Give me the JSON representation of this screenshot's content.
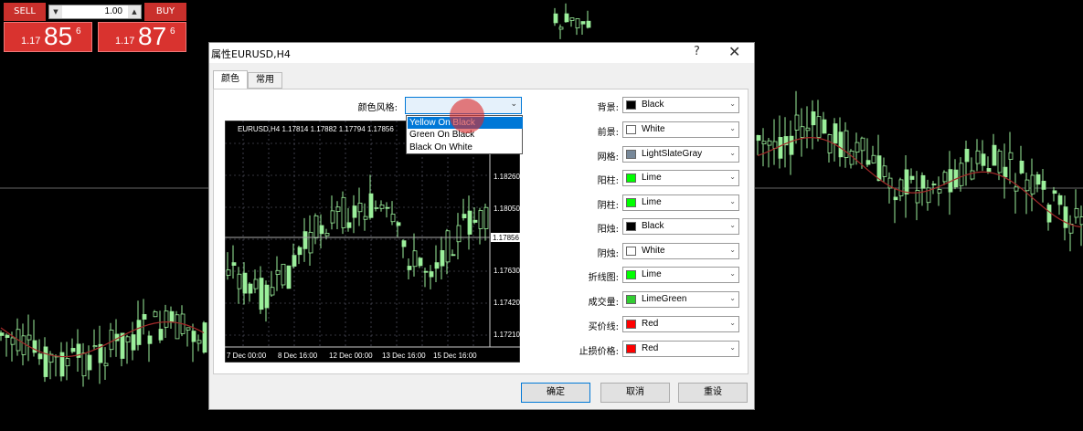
{
  "trade_panel": {
    "sell_label": "SELL",
    "buy_label": "BUY",
    "lot": "1.00",
    "sell_price": {
      "prefix": "1.17",
      "big": "85",
      "sup": "6"
    },
    "buy_price": {
      "prefix": "1.17",
      "big": "87",
      "sup": "6"
    }
  },
  "dialog": {
    "title": "属性EURUSD,H4",
    "help": "?",
    "close": "✕",
    "tabs": [
      "颜色",
      "常用"
    ],
    "scheme_label": "颜色风格:",
    "scheme_options": [
      "Yellow On Black",
      "Green On Black",
      "Black On White"
    ],
    "scheme_selected_index": 0,
    "properties": [
      {
        "label": "背景:",
        "color": "#000000",
        "name": "Black"
      },
      {
        "label": "前景:",
        "color": "#ffffff",
        "name": "White"
      },
      {
        "label": "网格:",
        "color": "#778899",
        "name": "LightSlateGray"
      },
      {
        "label": "阳柱:",
        "color": "#00ff00",
        "name": "Lime"
      },
      {
        "label": "阴柱:",
        "color": "#00ff00",
        "name": "Lime"
      },
      {
        "label": "阳烛:",
        "color": "#000000",
        "name": "Black"
      },
      {
        "label": "阴烛:",
        "color": "#ffffff",
        "name": "White"
      },
      {
        "label": "折线图:",
        "color": "#00ff00",
        "name": "Lime"
      },
      {
        "label": "成交量:",
        "color": "#32cd32",
        "name": "LimeGreen"
      },
      {
        "label": "买价线:",
        "color": "#ff0000",
        "name": "Red"
      },
      {
        "label": "止损价格:",
        "color": "#ff0000",
        "name": "Red"
      }
    ],
    "buttons": {
      "ok": "确定",
      "cancel": "取消",
      "reset": "重设"
    },
    "preview": {
      "header": "EURUSD,H4  1.17814 1.17882 1.17794 1.17856",
      "price_labels": [
        "1.18260",
        "1.18050",
        "1.17856",
        "1.17630",
        "1.17420",
        "1.17210"
      ],
      "date_labels": [
        "7 Dec 00:00",
        "8 Dec 16:00",
        "12 Dec 00:00",
        "13 Dec 16:00",
        "15 Dec 16:00"
      ]
    }
  },
  "colors": {
    "candle": "#9bef9b",
    "ma": "#a52a2a",
    "panel_red": "#d9332f"
  }
}
